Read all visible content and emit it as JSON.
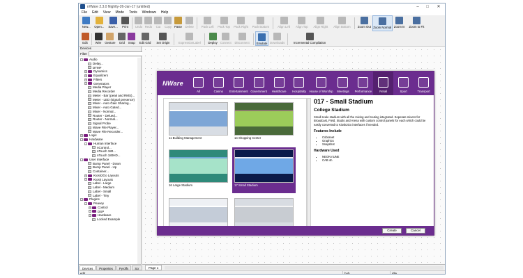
{
  "window": {
    "title": "n/Ware 2.3.0 Nightly-26-Jan-17 (untitled)"
  },
  "menu": [
    "File",
    "Edit",
    "View",
    "Mode",
    "Tools",
    "Windows",
    "Help"
  ],
  "toolbar1": [
    {
      "label": "New...",
      "disabled": false,
      "icon": "new-file-icon",
      "color": "#3e7bc4"
    },
    {
      "label": "Open...",
      "disabled": false,
      "icon": "open-folder-icon",
      "color": "#e3b23c"
    },
    {
      "label": "Save...",
      "disabled": false,
      "icon": "save-icon",
      "color": "#3a5fa8"
    },
    {
      "label": "Print",
      "disabled": false,
      "icon": "print-icon",
      "color": "#555555"
    },
    {
      "label": "Undo",
      "disabled": true,
      "icon": "undo-icon",
      "color": "#b8b8b8"
    },
    {
      "label": "Redo",
      "disabled": true,
      "icon": "redo-icon",
      "color": "#b8b8b8"
    },
    {
      "label": "Cut",
      "disabled": true,
      "icon": "cut-icon",
      "color": "#b8b8b8"
    },
    {
      "label": "Copy",
      "disabled": true,
      "icon": "copy-icon",
      "color": "#b8b8b8"
    },
    {
      "label": "Paste",
      "disabled": false,
      "icon": "paste-icon",
      "color": "#c79a3b"
    },
    {
      "label": "Delete",
      "disabled": true,
      "icon": "delete-icon",
      "color": "#b8b8b8"
    },
    {
      "label": "Pack Left",
      "disabled": true,
      "icon": "pack-left-icon",
      "color": "#b8b8b8"
    },
    {
      "label": "Pack Top",
      "disabled": true,
      "icon": "pack-top-icon",
      "color": "#b8b8b8"
    },
    {
      "label": "Pack Right",
      "disabled": true,
      "icon": "pack-right-icon",
      "color": "#b8b8b8"
    },
    {
      "label": "Pack Bottom",
      "disabled": true,
      "icon": "pack-bottom-icon",
      "color": "#b8b8b8"
    },
    {
      "label": "Align Left",
      "disabled": true,
      "icon": "align-left-icon",
      "color": "#b8b8b8"
    },
    {
      "label": "Align Top",
      "disabled": true,
      "icon": "align-top-icon",
      "color": "#b8b8b8"
    },
    {
      "label": "Align Right",
      "disabled": true,
      "icon": "align-right-icon",
      "color": "#b8b8b8"
    },
    {
      "label": "Align Bottom",
      "disabled": true,
      "icon": "align-bottom-icon",
      "color": "#b8b8b8"
    },
    {
      "label": "Zoom Out",
      "disabled": false,
      "icon": "zoom-out-icon",
      "color": "#4a6fa0"
    },
    {
      "label": "Zoom Normal",
      "disabled": false,
      "icon": "zoom-normal-icon",
      "color": "#4a6fa0",
      "selected": true
    },
    {
      "label": "Zoom In",
      "disabled": false,
      "icon": "zoom-in-icon",
      "color": "#4a6fa0"
    },
    {
      "label": "Zoom to Fit",
      "disabled": false,
      "icon": "zoom-fit-icon",
      "color": "#4a6fa0"
    }
  ],
  "toolbar2": [
    {
      "label": "Edit",
      "disabled": false,
      "icon": "edit-pencil-icon",
      "color": "#c05a2a"
    },
    {
      "label": "Wire",
      "disabled": false,
      "icon": "wire-icon",
      "color": "#333333"
    },
    {
      "label": "Gesture",
      "disabled": false,
      "icon": "gesture-hand-icon",
      "color": "#d1a46a"
    },
    {
      "label": "Grid",
      "disabled": false,
      "icon": "grid-icon",
      "color": "#666666"
    },
    {
      "label": "Snap",
      "disabled": false,
      "icon": "snap-icon",
      "color": "#8a3a9e"
    },
    {
      "label": "Edit Grid",
      "disabled": false,
      "icon": "edit-grid-icon",
      "color": "#666666"
    },
    {
      "label": "Set Origin",
      "disabled": false,
      "icon": "set-origin-icon",
      "color": "#555555"
    },
    {
      "label": "ExpressionLabel",
      "disabled": true,
      "icon": "expression-label-icon",
      "color": "#b8b8b8"
    },
    {
      "label": "Deploy",
      "disabled": false,
      "icon": "deploy-icon",
      "color": "#4a8a4a"
    },
    {
      "label": "Connect",
      "disabled": true,
      "icon": "connect-icon",
      "color": "#b8b8b8"
    },
    {
      "label": "Disconnect",
      "disabled": true,
      "icon": "disconnect-icon",
      "color": "#b8b8b8"
    },
    {
      "label": "Emulate",
      "disabled": false,
      "icon": "emulate-icon",
      "color": "#3a6fb0",
      "selected": true
    },
    {
      "label": "Downloads",
      "disabled": true,
      "icon": "downloads-icon",
      "color": "#b8b8b8"
    },
    {
      "label": "Incremental Compilation",
      "disabled": false,
      "icon": "incremental-compilation-icon",
      "color": "#555555"
    }
  ],
  "devices": {
    "header": "Devices",
    "filter_label": "Filter",
    "filter_value": "",
    "apply_label": "Apply",
    "clear_label": "Clear",
    "tree": [
      {
        "label": "Audio",
        "depth": 1,
        "type": "folder",
        "expander": "-"
      },
      {
        "label": "Delay...",
        "depth": 2,
        "type": "item",
        "expander": ""
      },
      {
        "label": "DTMF",
        "depth": 2,
        "type": "item",
        "expander": ""
      },
      {
        "label": "Dynamics",
        "depth": 2,
        "type": "folder",
        "expander": "+"
      },
      {
        "label": "Equalizers",
        "depth": 2,
        "type": "folder",
        "expander": "+"
      },
      {
        "label": "Filters",
        "depth": 2,
        "type": "folder",
        "expander": "+"
      },
      {
        "label": "Generators",
        "depth": 2,
        "type": "folder",
        "expander": "+"
      },
      {
        "label": "Media Player",
        "depth": 2,
        "type": "item",
        "expander": ""
      },
      {
        "label": "Media Recorder",
        "depth": 2,
        "type": "item",
        "expander": ""
      },
      {
        "label": "Meter - Bar (peak and RMS)...",
        "depth": 2,
        "type": "item",
        "expander": ""
      },
      {
        "label": "Meter - LED (signal presence)",
        "depth": 2,
        "type": "item",
        "expander": ""
      },
      {
        "label": "Mixer - Auto Gain Sharing...",
        "depth": 2,
        "type": "item",
        "expander": ""
      },
      {
        "label": "Mixer - Auto Gated...",
        "depth": 2,
        "type": "item",
        "expander": ""
      },
      {
        "label": "Mixer - Normal...",
        "depth": 2,
        "type": "item",
        "expander": ""
      },
      {
        "label": "Router - Delued...",
        "depth": 2,
        "type": "item",
        "expander": ""
      },
      {
        "label": "Router - Normal...",
        "depth": 2,
        "type": "item",
        "expander": ""
      },
      {
        "label": "Signal Probe",
        "depth": 2,
        "type": "item",
        "expander": ""
      },
      {
        "label": "Wave File Player...",
        "depth": 2,
        "type": "item",
        "expander": ""
      },
      {
        "label": "Wave File Recorder...",
        "depth": 2,
        "type": "item",
        "expander": ""
      },
      {
        "label": "Logic",
        "depth": 1,
        "type": "folder",
        "expander": "+"
      },
      {
        "label": "Hardware",
        "depth": 1,
        "type": "folder",
        "expander": "-"
      },
      {
        "label": "Human Interface",
        "depth": 2,
        "type": "folder",
        "expander": "-"
      },
      {
        "label": "nControl...",
        "depth": 3,
        "type": "item",
        "expander": ""
      },
      {
        "label": "nTouch 180...",
        "depth": 3,
        "type": "item",
        "expander": ""
      },
      {
        "label": "nTouch 180HD...",
        "depth": 3,
        "type": "item",
        "expander": ""
      },
      {
        "label": "User Interface",
        "depth": 1,
        "type": "folder",
        "expander": "-"
      },
      {
        "label": "Bump Panel - Down",
        "depth": 2,
        "type": "item",
        "expander": ""
      },
      {
        "label": "Bump Panel - Up",
        "depth": 2,
        "type": "item",
        "expander": ""
      },
      {
        "label": "Container...",
        "depth": 2,
        "type": "item",
        "expander": ""
      },
      {
        "label": "Kiosk2Go Layouts",
        "depth": 2,
        "type": "folder",
        "expander": "+"
      },
      {
        "label": "Kiosk Layouts",
        "depth": 2,
        "type": "folder",
        "expander": "+"
      },
      {
        "label": "Label - Large",
        "depth": 2,
        "type": "item",
        "expander": ""
      },
      {
        "label": "Label - Medium",
        "depth": 2,
        "type": "item",
        "expander": ""
      },
      {
        "label": "Label - Small",
        "depth": 2,
        "type": "item",
        "expander": ""
      },
      {
        "label": "Label - Tiny",
        "depth": 2,
        "type": "item",
        "expander": ""
      },
      {
        "label": "Plugins",
        "depth": 1,
        "type": "folder",
        "expander": "-"
      },
      {
        "label": "Peavey",
        "depth": 2,
        "type": "folder",
        "expander": "-"
      },
      {
        "label": "Control",
        "depth": 3,
        "type": "folder",
        "expander": "+"
      },
      {
        "label": "DSP",
        "depth": 3,
        "type": "folder",
        "expander": "+"
      },
      {
        "label": "Hardware",
        "depth": 3,
        "type": "folder",
        "expander": "+"
      },
      {
        "label": "Locked Example",
        "depth": 3,
        "type": "item",
        "expander": ""
      }
    ]
  },
  "left_tabs": [
    "Devices",
    "Properties",
    "Pyroffs",
    "Scr"
  ],
  "canvas_tab": "Page 1",
  "status": {
    "left": "edit",
    "user": "bob",
    "state": "idle"
  },
  "kiosk": {
    "brand": "NWare",
    "categories": [
      {
        "label": "All",
        "icon": "tag-icon"
      },
      {
        "label": "Casino",
        "icon": "casino-mask-icon"
      },
      {
        "label": "Entertainment",
        "icon": "theatre-masks-icon"
      },
      {
        "label": "Government",
        "icon": "government-building-icon"
      },
      {
        "label": "Healthcare",
        "icon": "hospital-icon"
      },
      {
        "label": "Hospitality",
        "icon": "coffee-cup-icon"
      },
      {
        "label": "House of Worship",
        "icon": "church-icon"
      },
      {
        "label": "Meetings",
        "icon": "meeting-icon"
      },
      {
        "label": "Performance",
        "icon": "performance-masks-icon"
      },
      {
        "label": "Retail",
        "icon": "shopping-cart-icon",
        "active": true
      },
      {
        "label": "Sport",
        "icon": "sport-icon"
      },
      {
        "label": "Transport",
        "icon": "bus-icon"
      }
    ],
    "thumbnails": [
      {
        "caption": "11 Building Management",
        "selected": false,
        "palette": [
          "#d8dde4",
          "#7ea6d6",
          "#ffffff"
        ]
      },
      {
        "caption": "14 Shopping Center",
        "selected": false,
        "palette": [
          "#4a6a3a",
          "#9ccc5a",
          "#8a7a6a"
        ]
      },
      {
        "caption": "16 Large Stadium",
        "selected": false,
        "palette": [
          "#2e8a7a",
          "#a6e3c9",
          "#6fa8d6"
        ]
      },
      {
        "caption": "17 Small Stadium",
        "selected": true,
        "palette": [
          "#0b1a4a",
          "#6fa8e6",
          "#e8e8f0"
        ]
      },
      {
        "caption": "",
        "selected": false,
        "palette": [
          "#eef0f4",
          "#c4ccd8",
          "#ffffff"
        ]
      },
      {
        "caption": "",
        "selected": false,
        "palette": [
          "#d8dce2",
          "#c8ccd2",
          "#f4f4f4"
        ]
      }
    ],
    "detail": {
      "title": "017 - Small Stadium",
      "subtitle": "College Stadium",
      "description": "Small scale stadium with all the mixing and routing integrated. Seperate mixers for Broadcast, Field, Studio and Arena with custom control panels for each which could be easily converted to Kiosk2Go interfaces if needed.",
      "features_heading": "Features Include",
      "features": [
        "Cobranet",
        "Graphics",
        "Snapshot"
      ],
      "hardware_heading": "Hardware Used",
      "hardware": [
        "NEON nUNE",
        "CAB 4n"
      ]
    },
    "create_label": "Create",
    "cancel_label": "Cancel",
    "accent": "#6b2d8f"
  }
}
